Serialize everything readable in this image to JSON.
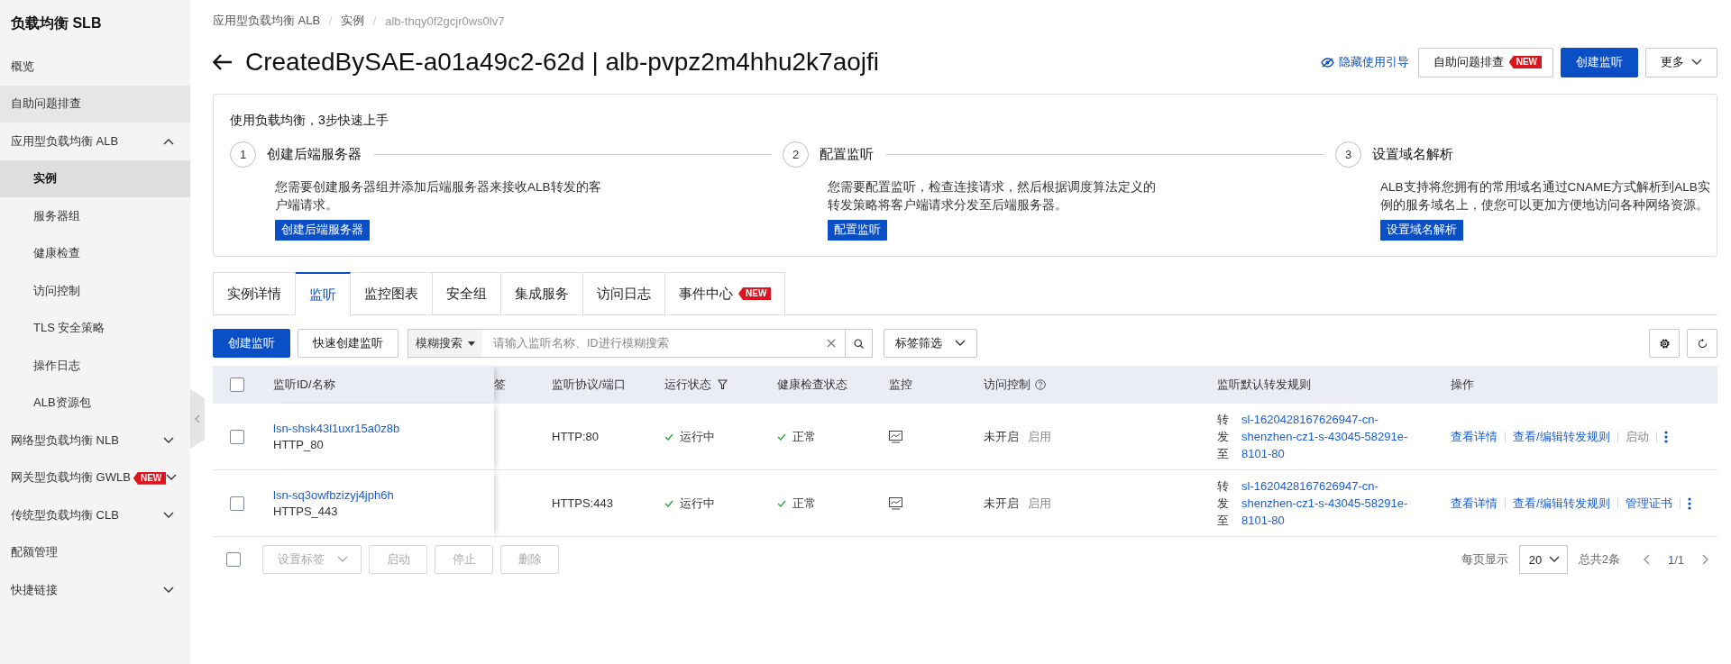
{
  "sidebar": {
    "title": "负载均衡 SLB",
    "items": [
      {
        "kind": "link",
        "label": "概览",
        "selected": false,
        "highlighted": false
      },
      {
        "kind": "link",
        "label": "自助问题排查",
        "selected": false,
        "highlighted": true
      },
      {
        "kind": "group",
        "label": "应用型负载均衡 ALB",
        "expanded": true,
        "children": [
          {
            "label": "实例",
            "selected": true
          },
          {
            "label": "服务器组",
            "selected": false
          },
          {
            "label": "健康检查",
            "selected": false
          },
          {
            "label": "访问控制",
            "selected": false
          },
          {
            "label": "TLS 安全策略",
            "selected": false
          },
          {
            "label": "操作日志",
            "selected": false
          },
          {
            "label": "ALB资源包",
            "selected": false
          }
        ]
      },
      {
        "kind": "group",
        "label": "网络型负载均衡 NLB",
        "expanded": false
      },
      {
        "kind": "group",
        "label": "网关型负载均衡 GWLB",
        "badge": "NEW",
        "expanded": false
      },
      {
        "kind": "group",
        "label": "传统型负载均衡 CLB",
        "expanded": false
      },
      {
        "kind": "link",
        "label": "配额管理",
        "selected": false,
        "highlighted": false
      },
      {
        "kind": "group",
        "label": "快捷链接",
        "expanded": false
      }
    ]
  },
  "header": {
    "breadcrumb": [
      "应用型负载均衡 ALB",
      "实例",
      "alb-thqy0f2gcjr0ws0lv7"
    ],
    "title": "CreatedBySAE-a01a49c2-62d | alb-pvpz2m4hhu2k7aojfi",
    "actions": [
      {
        "kind": "link",
        "label": "隐藏使用引导"
      },
      {
        "kind": "button",
        "label": "自助问题排查",
        "badge": "NEW"
      },
      {
        "kind": "primary",
        "label": "创建监听"
      },
      {
        "kind": "dropdown",
        "label": "更多"
      }
    ]
  },
  "guide": {
    "title": "使用负载均衡，3步快速上手",
    "steps": [
      {
        "number": "1",
        "title": "创建后端服务器",
        "description": "您需要创建服务器组并添加后端服务器来接收ALB转发的客户端请求。",
        "button": "创建后端服务器"
      },
      {
        "number": "2",
        "title": "配置监听",
        "description": "您需要配置监听，检查连接请求，然后根据调度算法定义的转发策略将客户端请求分发至后端服务器。",
        "button": "配置监听"
      },
      {
        "number": "3",
        "title": "设置域名解析",
        "description": "ALB支持将您拥有的常用域名通过CNAME方式解析到ALB实例的服务域名上，使您可以更加方便地访问各种网络资源。",
        "button": "设置域名解析"
      }
    ]
  },
  "tabs": [
    {
      "label": "实例详情",
      "selected": false
    },
    {
      "label": "监听",
      "selected": true
    },
    {
      "label": "监控图表",
      "selected": false
    },
    {
      "label": "安全组",
      "selected": false
    },
    {
      "label": "集成服务",
      "selected": false
    },
    {
      "label": "访问日志",
      "selected": false
    },
    {
      "label": "事件中心",
      "selected": false,
      "badge": "NEW"
    }
  ],
  "toolbar": {
    "create_button": "创建监听",
    "quick_button": "快速创建监听",
    "search_mode": "模糊搜索",
    "search": {
      "placeholder": "请输入监听名称、ID进行模糊搜索"
    },
    "tag_filter": "标签筛选"
  },
  "table": {
    "header_checked": false,
    "columns": [
      "监听ID/名称",
      "签",
      "监听协议/端口",
      "运行状态",
      "健康检查状态",
      "监控",
      "访问控制",
      "监听默认转发规则",
      "操作"
    ],
    "rows": [
      {
        "checked": false,
        "id": "lsn-shsk43l1uxr15a0z8b",
        "name": "HTTP_80",
        "protocol": "HTTP:80",
        "status": {
          "kind": "ok",
          "text": "运行中"
        },
        "health": {
          "kind": "ok",
          "text": "正常"
        },
        "acl": "未开启",
        "acl_action": "启用",
        "rule_prefix": "转发至",
        "rule": "sl-1620428167626947-cn-shenzhen-cz1-s-43045-58291e-8101-80",
        "actions": [
          {
            "label": "查看详情",
            "disabled": false
          },
          {
            "label": "查看/编辑转发规则",
            "disabled": false
          },
          {
            "label": "启动",
            "disabled": true
          }
        ]
      },
      {
        "checked": false,
        "id": "lsn-sq3owfbzizyj4jph6h",
        "name": "HTTPS_443",
        "protocol": "HTTPS:443",
        "status": {
          "kind": "ok",
          "text": "运行中"
        },
        "health": {
          "kind": "ok",
          "text": "正常"
        },
        "acl": "未开启",
        "acl_action": "启用",
        "rule_prefix": "转发至",
        "rule": "sl-1620428167626947-cn-shenzhen-cz1-s-43045-58291e-8101-80",
        "actions": [
          {
            "label": "查看详情",
            "disabled": false
          },
          {
            "label": "查看/编辑转发规则",
            "disabled": false
          },
          {
            "label": "管理证书",
            "disabled": false
          }
        ]
      }
    ]
  },
  "footer": {
    "checked": false,
    "buttons": [
      {
        "kind": "dropdown",
        "label": "设置标签",
        "disabled": true
      },
      {
        "kind": "button",
        "label": "启动",
        "disabled": true
      },
      {
        "kind": "button",
        "label": "停止",
        "disabled": true
      },
      {
        "kind": "button",
        "label": "删除",
        "disabled": true
      }
    ],
    "page_size_label": "每页显示",
    "page_size": "20",
    "total": "总共2条",
    "page": "1",
    "page_of": "/1"
  }
}
